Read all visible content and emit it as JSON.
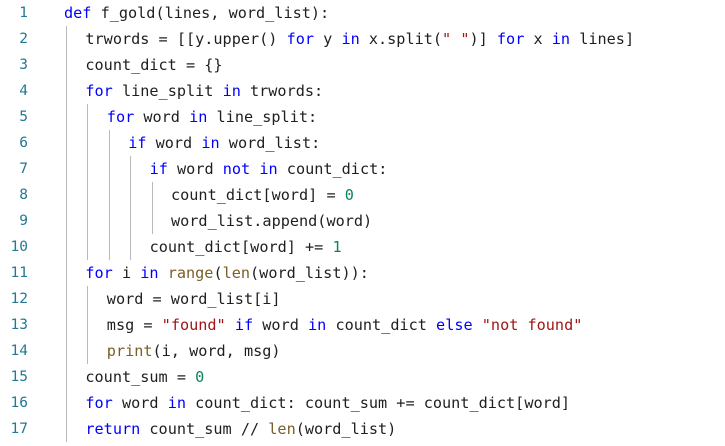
{
  "editor": {
    "colors": {
      "keyword": "#0000ff",
      "builtin": "#795e26",
      "string": "#a31515",
      "number": "#098658",
      "line_number": "#237893",
      "text": "#1f1f1f"
    },
    "lines": [
      {
        "number": "1",
        "indent": 0,
        "tokens": [
          [
            "kw",
            "def"
          ],
          [
            "pl",
            " f_gold(lines, word_list):"
          ]
        ]
      },
      {
        "number": "2",
        "indent": 1,
        "tokens": [
          [
            "pl",
            "trwords = [[y.upper() "
          ],
          [
            "kw",
            "for"
          ],
          [
            "pl",
            " y "
          ],
          [
            "kw",
            "in"
          ],
          [
            "pl",
            " x.split("
          ],
          [
            "str",
            "\" \""
          ],
          [
            "pl",
            ")] "
          ],
          [
            "kw",
            "for"
          ],
          [
            "pl",
            " x "
          ],
          [
            "kw",
            "in"
          ],
          [
            "pl",
            " lines]"
          ]
        ]
      },
      {
        "number": "3",
        "indent": 1,
        "tokens": [
          [
            "pl",
            "count_dict = {}"
          ]
        ]
      },
      {
        "number": "4",
        "indent": 1,
        "tokens": [
          [
            "kw",
            "for"
          ],
          [
            "pl",
            " line_split "
          ],
          [
            "kw",
            "in"
          ],
          [
            "pl",
            " trwords:"
          ]
        ]
      },
      {
        "number": "5",
        "indent": 2,
        "tokens": [
          [
            "kw",
            "for"
          ],
          [
            "pl",
            " word "
          ],
          [
            "kw",
            "in"
          ],
          [
            "pl",
            " line_split:"
          ]
        ]
      },
      {
        "number": "6",
        "indent": 3,
        "tokens": [
          [
            "kw",
            "if"
          ],
          [
            "pl",
            " word "
          ],
          [
            "kw",
            "in"
          ],
          [
            "pl",
            " word_list:"
          ]
        ]
      },
      {
        "number": "7",
        "indent": 4,
        "tokens": [
          [
            "kw",
            "if"
          ],
          [
            "pl",
            " word "
          ],
          [
            "kw",
            "not"
          ],
          [
            "pl",
            " "
          ],
          [
            "kw",
            "in"
          ],
          [
            "pl",
            " count_dict:"
          ]
        ]
      },
      {
        "number": "8",
        "indent": 5,
        "tokens": [
          [
            "pl",
            "count_dict[word] = "
          ],
          [
            "num",
            "0"
          ]
        ]
      },
      {
        "number": "9",
        "indent": 5,
        "tokens": [
          [
            "pl",
            "word_list.append(word)"
          ]
        ]
      },
      {
        "number": "10",
        "indent": 4,
        "tokens": [
          [
            "pl",
            "count_dict[word] += "
          ],
          [
            "num",
            "1"
          ]
        ]
      },
      {
        "number": "11",
        "indent": 1,
        "tokens": [
          [
            "kw",
            "for"
          ],
          [
            "pl",
            " i "
          ],
          [
            "kw",
            "in"
          ],
          [
            "pl",
            " "
          ],
          [
            "fn",
            "range"
          ],
          [
            "pl",
            "("
          ],
          [
            "fn",
            "len"
          ],
          [
            "pl",
            "(word_list)):"
          ]
        ]
      },
      {
        "number": "12",
        "indent": 2,
        "tokens": [
          [
            "pl",
            "word = word_list[i]"
          ]
        ]
      },
      {
        "number": "13",
        "indent": 2,
        "tokens": [
          [
            "pl",
            "msg = "
          ],
          [
            "str",
            "\"found\""
          ],
          [
            "pl",
            " "
          ],
          [
            "kw",
            "if"
          ],
          [
            "pl",
            " word "
          ],
          [
            "kw",
            "in"
          ],
          [
            "pl",
            " count_dict "
          ],
          [
            "kw",
            "else"
          ],
          [
            "pl",
            " "
          ],
          [
            "str",
            "\"not found\""
          ]
        ]
      },
      {
        "number": "14",
        "indent": 2,
        "tokens": [
          [
            "fn",
            "print"
          ],
          [
            "pl",
            "(i, word, msg)"
          ]
        ]
      },
      {
        "number": "15",
        "indent": 1,
        "tokens": [
          [
            "pl",
            "count_sum = "
          ],
          [
            "num",
            "0"
          ]
        ]
      },
      {
        "number": "16",
        "indent": 1,
        "tokens": [
          [
            "kw",
            "for"
          ],
          [
            "pl",
            " word "
          ],
          [
            "kw",
            "in"
          ],
          [
            "pl",
            " count_dict: count_sum += count_dict[word]"
          ]
        ]
      },
      {
        "number": "17",
        "indent": 1,
        "tokens": [
          [
            "kw",
            "return"
          ],
          [
            "pl",
            " count_sum // "
          ],
          [
            "fn",
            "len"
          ],
          [
            "pl",
            "(word_list)"
          ]
        ]
      }
    ]
  }
}
